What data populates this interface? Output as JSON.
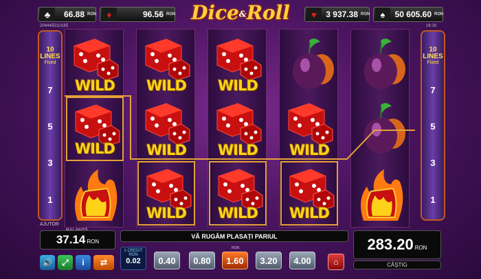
{
  "header": {
    "jackpots": [
      {
        "suit": "♣",
        "value": "66.88",
        "currency": "RON",
        "color": "#ffffff"
      },
      {
        "suit": "♦",
        "value": "96.56",
        "currency": "RON",
        "color": "#e02020"
      },
      {
        "suit": "♥",
        "value": "3 937.38",
        "currency": "RON",
        "color": "#e02020"
      },
      {
        "suit": "♠",
        "value": "50 605.60",
        "currency": "RON",
        "color": "#ffffff"
      }
    ],
    "logo_part1": "Dice",
    "logo_amp": "&",
    "logo_part2": "Roll",
    "left_id": "20444551U165",
    "right_id": "16:18"
  },
  "lines_panel": {
    "count": "10",
    "label": "LINES",
    "fixed": "Fixed",
    "numbers": [
      "7",
      "5",
      "3",
      "1"
    ]
  },
  "reels": [
    [
      "dice-wild",
      "dice-wild",
      "fire-bar"
    ],
    [
      "dice-wild",
      "dice-wild",
      "dice-wild"
    ],
    [
      "dice-wild",
      "dice-wild",
      "dice-wild"
    ],
    [
      "plum",
      "dice-wild",
      "dice-wild"
    ],
    [
      "plum",
      "plum",
      "fire-bar"
    ]
  ],
  "wild_label": "WILD",
  "bottom": {
    "ajutor_label": "AJUTOR",
    "balance_label": "BALANȚĂ",
    "balance_value": "37.14",
    "balance_currency": "RON",
    "message": "VĂ RUGĂM PLASAȚI PARIUL",
    "credit_label": "1 CREDIT",
    "credit_currency": "RON",
    "credit_value": "0.02",
    "bets": [
      "0.40",
      "0.80",
      "1.60",
      "3.20",
      "4.00"
    ],
    "bets_selected_index": 2,
    "bet_tag": "RON",
    "win_value": "283.20",
    "win_currency": "RON",
    "win_label": "CÂȘTIG"
  }
}
